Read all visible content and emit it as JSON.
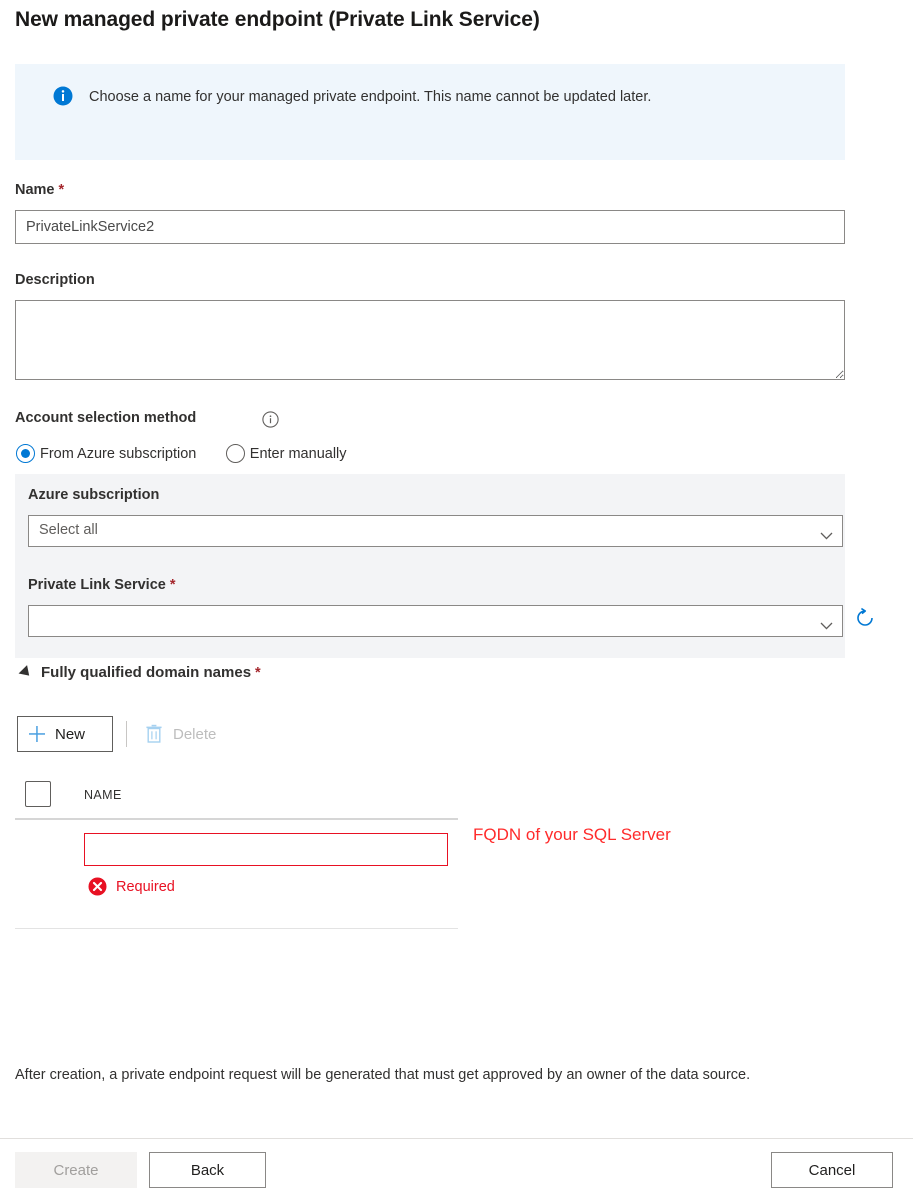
{
  "page": {
    "title": "New managed private endpoint (Private Link Service)"
  },
  "info_banner": {
    "icon": "info-icon",
    "text": "Choose a name for your managed private endpoint. This name cannot be updated later."
  },
  "form": {
    "name": {
      "label": "Name",
      "required_marker": "*",
      "value": "PrivateLinkService2",
      "placeholder": ""
    },
    "description": {
      "label": "Description",
      "value": "",
      "placeholder": ""
    },
    "account_selection": {
      "label": "Account selection method",
      "info_icon": "info-circle-icon",
      "options": [
        {
          "label": "From Azure subscription",
          "selected": true
        },
        {
          "label": "Enter manually",
          "selected": false
        }
      ]
    },
    "azure_subscription": {
      "label": "Azure subscription",
      "value": "Select all",
      "chevron": "chevron-down-icon"
    },
    "private_link_service": {
      "label": "Private Link Service",
      "required_marker": "*",
      "value": "",
      "chevron": "chevron-down-icon",
      "refresh_icon": "refresh-icon"
    }
  },
  "fqdn_section": {
    "header": "Fully qualified domain names",
    "required_marker": "*",
    "collapse_icon": "triangle-collapse-icon",
    "toolbar": {
      "new_label": "New",
      "new_icon": "plus-icon",
      "delete_label": "Delete",
      "delete_icon": "trash-icon",
      "delete_disabled": true
    },
    "grid": {
      "columns": [
        "NAME"
      ],
      "rows": [
        {
          "name_value": "",
          "error": "Required",
          "error_icon": "error-x-icon"
        }
      ]
    },
    "annotation": "FQDN of your SQL Server"
  },
  "footer": {
    "note": "After creation, a private endpoint request will be generated that must get approved by an owner of the data source.",
    "buttons": {
      "create": "Create",
      "back": "Back",
      "cancel": "Cancel"
    }
  },
  "colors": {
    "accent_blue": "#0078d4",
    "banner_bg": "#eff6fc",
    "panel_bg": "#f3f4f6",
    "error_red": "#e81123",
    "annotation_red": "#ff2b2b",
    "required_star": "#a4262c"
  }
}
